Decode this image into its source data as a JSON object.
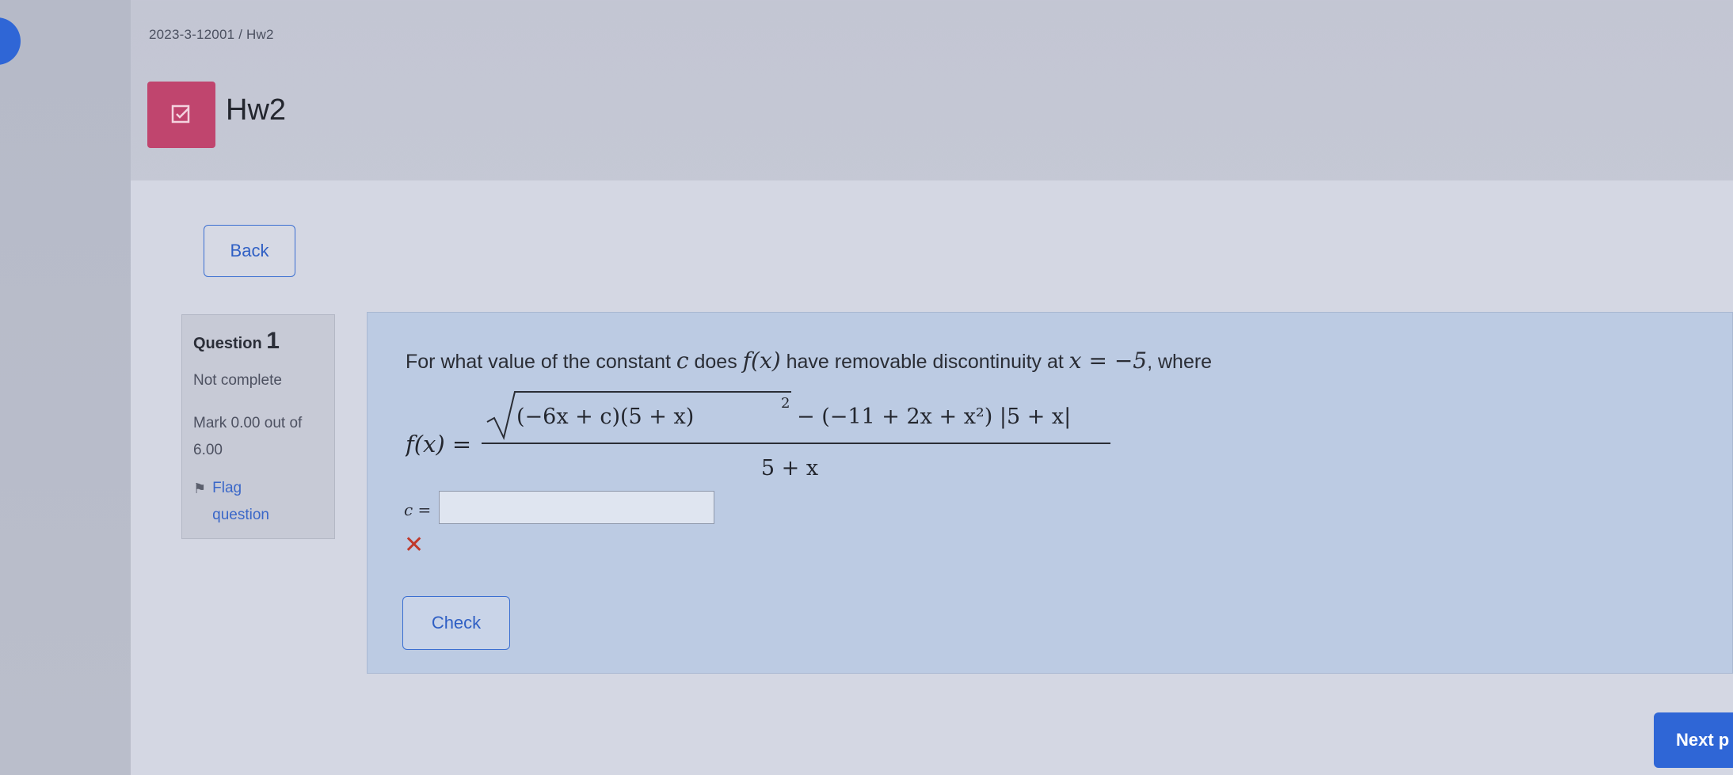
{
  "breadcrumb": "2023-3-12001 / Hw2",
  "page": {
    "title": "Hw2",
    "icon": "assignment-check-icon"
  },
  "nav": {
    "back_label": "Back",
    "next_label": "Next p"
  },
  "question_info": {
    "label": "Question",
    "number": "1",
    "state": "Not complete",
    "mark": "Mark 0.00 out of 6.00",
    "flag_label": "Flag question"
  },
  "question": {
    "prompt_before_c": "For what value of the constant ",
    "constant_symbol": "c",
    "prompt_middle": " does ",
    "function_symbol": "f(x)",
    "prompt_after_f": " have removable discontinuity at ",
    "point": "x = −5",
    "prompt_end": ", where",
    "lhs": "f(x) =",
    "numerator_root": "(−6x + c)(5 + x)",
    "numerator_rest": "− (−11 + 2x + x²) |5 + x|",
    "denominator": "5 + x",
    "answer_label": "c =",
    "answer_value": "",
    "check_label": "Check"
  },
  "colors": {
    "accent": "#2f66d6",
    "activity_icon_bg": "#c0456e",
    "incorrect": "#c0392b"
  }
}
